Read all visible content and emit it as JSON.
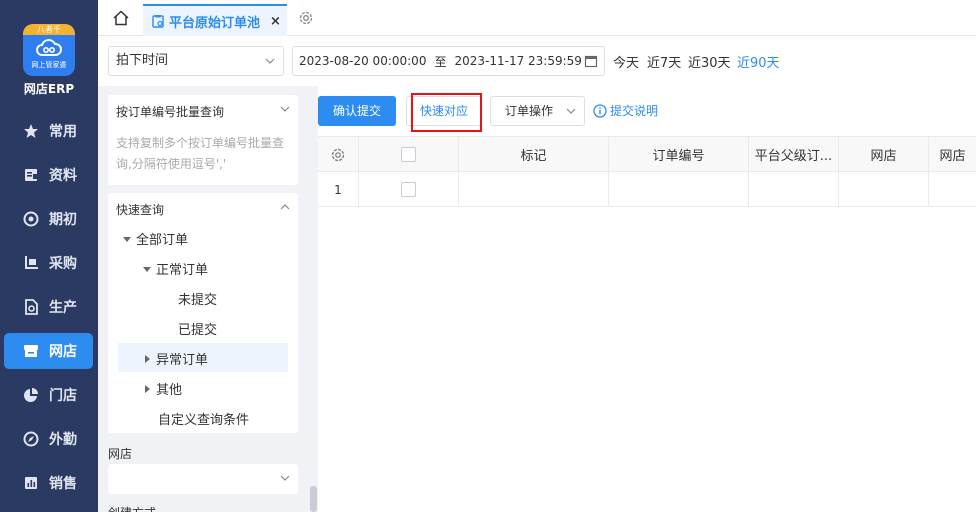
{
  "colors": {
    "nav_bg": "#2a3a63",
    "accent": "#2d8cf0",
    "highlight": "#e8121b",
    "logo_ribbon": "#f4b232"
  },
  "app": {
    "logo_ribbon": "八者千",
    "logo_sub": "网上管家婆",
    "name": "网店ERP"
  },
  "nav": [
    {
      "label": "常用",
      "icon": "star-icon"
    },
    {
      "label": "资料",
      "icon": "document-icon"
    },
    {
      "label": "期初",
      "icon": "target-icon"
    },
    {
      "label": "采购",
      "icon": "purchase-icon"
    },
    {
      "label": "生产",
      "icon": "production-icon"
    },
    {
      "label": "网店",
      "icon": "store-icon",
      "active": true
    },
    {
      "label": "门店",
      "icon": "pie-icon"
    },
    {
      "label": "外勤",
      "icon": "compass-icon"
    },
    {
      "label": "销售",
      "icon": "bar-chart-icon"
    }
  ],
  "tabs": {
    "active_label": "平台原始订单池",
    "close": "×"
  },
  "filter": {
    "time_type": "拍下时间",
    "date_from": "2023-08-20 00:00:00",
    "range_sep": "至",
    "date_to": "2023-11-17 23:59:59",
    "quick": [
      "今天",
      "近7天",
      "近30天",
      "近90天"
    ]
  },
  "left": {
    "batch_title": "按订单编号批量查询",
    "batch_hint": "支持复制多个按订单编号批量查询,分隔符使用逗号','",
    "quick_title": "快速查询",
    "tree": {
      "all": "全部订单",
      "normal": "正常订单",
      "unsubmitted": "未提交",
      "submitted": "已提交",
      "abnormal": "异常订单",
      "other": "其他",
      "custom": "自定义查询条件"
    },
    "shop_label": "网店",
    "create_label": "创建方式"
  },
  "toolbar": {
    "confirm": "确认提交",
    "quick_match": "快速对应",
    "order_ops": "订单操作",
    "help": "提交说明"
  },
  "table": {
    "headers": [
      "标记",
      "订单编号",
      "平台父级订...",
      "网店",
      "网店"
    ],
    "rows": [
      {
        "index": "1"
      }
    ]
  }
}
